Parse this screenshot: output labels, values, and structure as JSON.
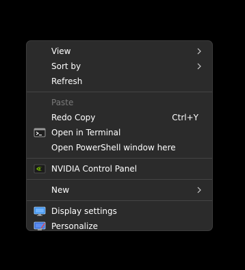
{
  "menu": {
    "items": [
      {
        "label": "View"
      },
      {
        "label": "Sort by"
      },
      {
        "label": "Refresh"
      },
      {
        "label": "Paste"
      },
      {
        "label": "Redo Copy",
        "shortcut": "Ctrl+Y"
      },
      {
        "label": "Open in Terminal",
        "icon": "terminal-icon"
      },
      {
        "label": "Open PowerShell window here"
      },
      {
        "label": "NVIDIA Control Panel",
        "icon": "nvidia-icon"
      },
      {
        "label": "New"
      },
      {
        "label": "Display settings",
        "icon": "display-icon"
      },
      {
        "label": "Personalize",
        "icon": "personalize-icon"
      }
    ]
  },
  "colors": {
    "background": "#000000",
    "menu_bg": "#2b2b2b",
    "text": "#ffffff",
    "disabled_text": "#7a7a7a",
    "separator": "#454545",
    "nvidia_green": "#76b900",
    "display_blue": "#3a8ee6"
  }
}
